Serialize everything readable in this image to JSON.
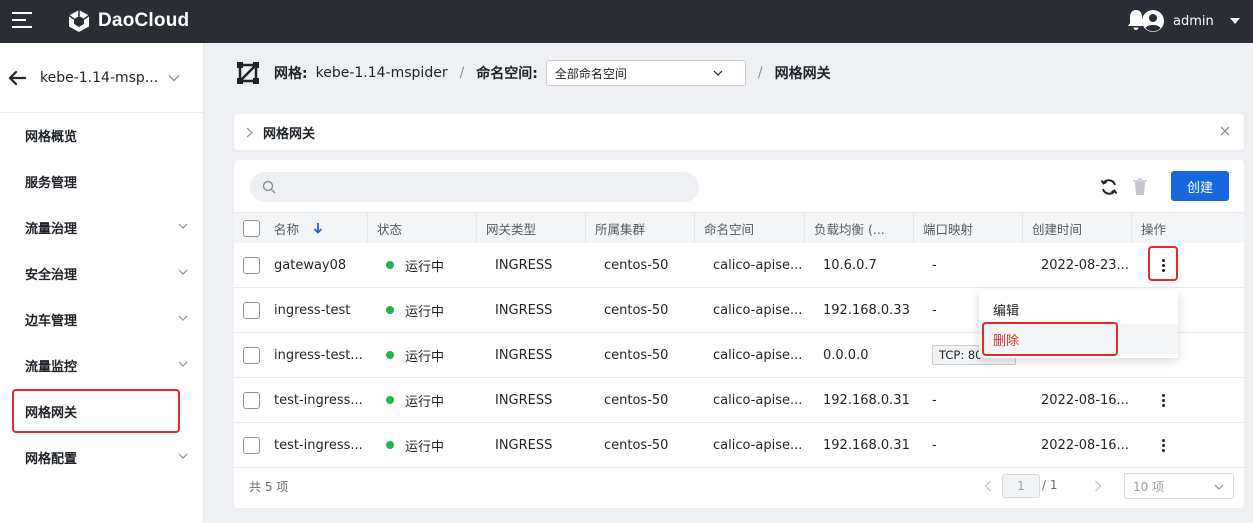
{
  "app": {
    "brand": "DaoCloud",
    "user": "admin"
  },
  "sidebar": {
    "mesh_name": "kebe-1.14-msp...",
    "items": [
      {
        "label": "网格概览",
        "expandable": false
      },
      {
        "label": "服务管理",
        "expandable": false
      },
      {
        "label": "流量治理",
        "expandable": true
      },
      {
        "label": "安全治理",
        "expandable": true
      },
      {
        "label": "边车管理",
        "expandable": true
      },
      {
        "label": "流量监控",
        "expandable": true
      },
      {
        "label": "网格网关",
        "expandable": false,
        "active": true
      },
      {
        "label": "网格配置",
        "expandable": true
      }
    ]
  },
  "breadcrumb": {
    "mesh_label": "网格:",
    "mesh_value": "kebe-1.14-mspider",
    "ns_label": "命名空间:",
    "ns_value": "全部命名空间",
    "current": "网格网关"
  },
  "section": {
    "title": "网格网关"
  },
  "toolbar": {
    "search_placeholder": "",
    "create_label": "创建"
  },
  "table": {
    "columns": [
      "名称",
      "状态",
      "网关类型",
      "所属集群",
      "命名空间",
      "负载均衡 (...",
      "端口映射",
      "创建时间",
      "操作"
    ],
    "rows": [
      {
        "name": "gateway08",
        "status": "运行中",
        "type": "INGRESS",
        "cluster": "centos-50",
        "namespace": "calico-apise...",
        "lb": "10.6.0.7",
        "ports": "-",
        "created": "2022-08-23..."
      },
      {
        "name": "ingress-test",
        "status": "运行中",
        "type": "INGRESS",
        "cluster": "centos-50",
        "namespace": "calico-apise...",
        "lb": "192.168.0.33",
        "ports": "-",
        "created": ""
      },
      {
        "name": "ingress-test...",
        "status": "运行中",
        "type": "INGRESS",
        "cluster": "centos-50",
        "namespace": "calico-apise...",
        "lb": "0.0.0.0",
        "ports_tag": "TCP: 80",
        "created": ""
      },
      {
        "name": "test-ingress...",
        "status": "运行中",
        "type": "INGRESS",
        "cluster": "centos-50",
        "namespace": "calico-apise...",
        "lb": "192.168.0.31",
        "ports": "-",
        "created": "2022-08-16..."
      },
      {
        "name": "test-ingress...",
        "status": "运行中",
        "type": "INGRESS",
        "cluster": "centos-50",
        "namespace": "calico-apise...",
        "lb": "192.168.0.31",
        "ports": "-",
        "created": "2022-08-16..."
      }
    ]
  },
  "menu": {
    "edit": "编辑",
    "delete": "删除"
  },
  "footer": {
    "count": "共 5 项",
    "page": "1",
    "total": "/ 1",
    "page_size": "10 项"
  },
  "colors": {
    "primary": "#1668dc",
    "danger": "#e22a2a",
    "running": "#22b34c",
    "topbar": "#2a2d34"
  }
}
